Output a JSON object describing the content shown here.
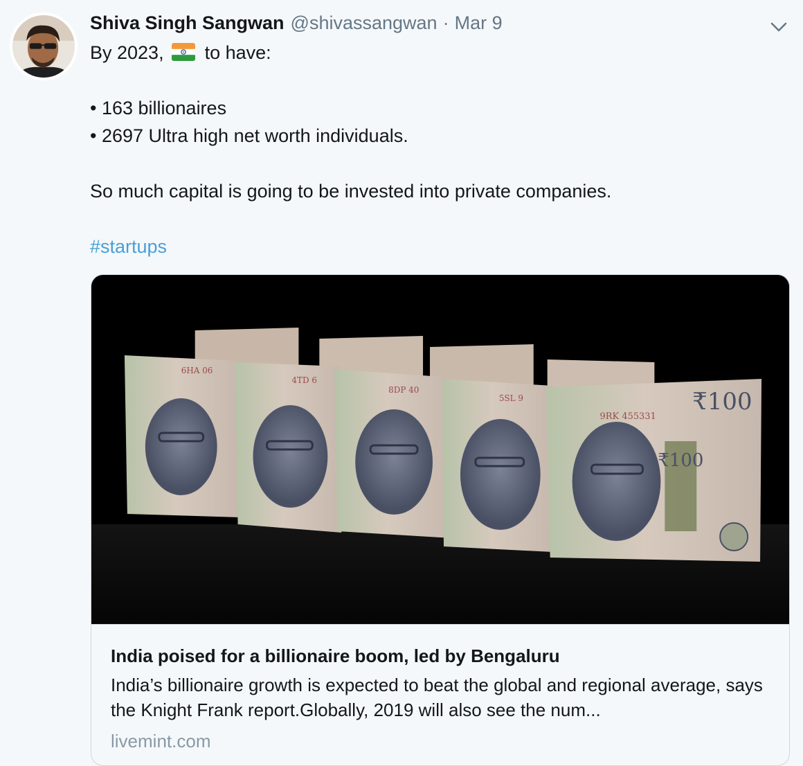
{
  "tweet": {
    "author_name": "Shiva Singh Sangwan",
    "author_handle": "@shivassangwan",
    "separator": "·",
    "date": "Mar 9",
    "lines": {
      "intro_before": "By 2023,",
      "intro_flag_icon": "india-flag-emoji",
      "intro_after": "to have:",
      "bullet1": "• 163 billionaires",
      "bullet2": "• 2697 Ultra high net worth individuals.",
      "capital": "So much capital is going to be invested into private companies.",
      "hashtag": "#startups"
    }
  },
  "card": {
    "title": "India poised for a billionaire boom, led by Bengaluru",
    "description": "India’s billionaire growth is expected to beat the global and regional average, says the Knight Frank report.Globally, 2019 will also see the num...",
    "domain": "livemint.com",
    "image_icon": "rupee-banknotes-image",
    "banknote_serials": [
      "6HA 06",
      "4TD 6",
      "8DP 40",
      "5SL 9",
      "9RK 455331"
    ],
    "banknote_denomination": "₹100"
  },
  "colors": {
    "background": "#f5f8fa",
    "link": "#4a9fd8",
    "secondary_text": "#657786",
    "border": "#ccd6dd"
  }
}
